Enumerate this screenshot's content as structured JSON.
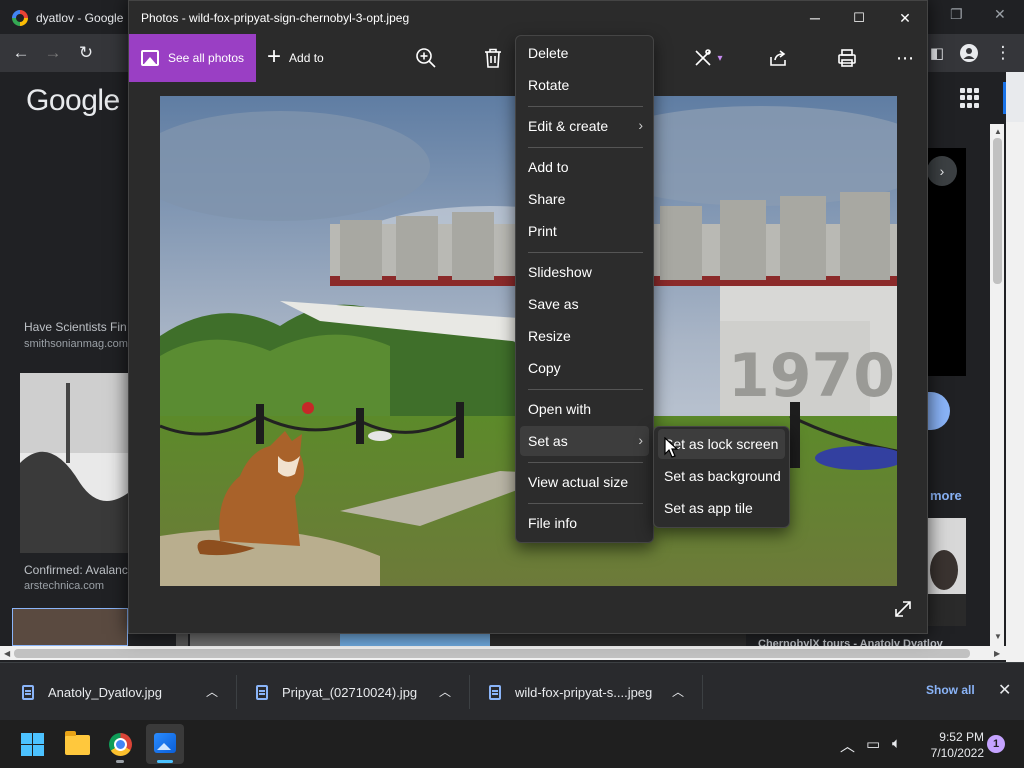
{
  "browser": {
    "tab_title": "dyatlov - Google",
    "logo_text": "Google",
    "cards": [
      {
        "title": "Have Scientists Fin",
        "source": "smithsonianmag.com"
      },
      {
        "title": "Confirmed: Avalanc",
        "source": "arstechnica.com"
      }
    ],
    "more_link": "more",
    "bottom_title": "ChernobylX tours - Anatoly Dyatlov"
  },
  "photos": {
    "window_title": "Photos - wild-fox-pripyat-sign-chernobyl-3-opt.jpeg",
    "see_all_label": "See all photos",
    "add_to_label": "Add to",
    "icons": [
      "zoom-in-icon",
      "delete-icon",
      "edit-icon",
      "share-icon",
      "print-icon",
      "more-icon",
      "expand-icon"
    ]
  },
  "context_menu": {
    "items": [
      {
        "label": "Delete"
      },
      {
        "label": "Rotate"
      },
      {
        "label": "Edit & create"
      },
      {
        "label": "Add to"
      },
      {
        "label": "Share"
      },
      {
        "label": "Print"
      },
      {
        "label": "Slideshow"
      },
      {
        "label": "Save as"
      },
      {
        "label": "Resize"
      },
      {
        "label": "Copy"
      },
      {
        "label": "Open with"
      },
      {
        "label": "Set as"
      },
      {
        "label": "View actual size"
      },
      {
        "label": "File info"
      }
    ],
    "submenu": [
      {
        "label": "Set as lock screen"
      },
      {
        "label": "Set as background"
      },
      {
        "label": "Set as app tile"
      }
    ]
  },
  "downloads": {
    "items": [
      {
        "name": "Anatoly_Dyatlov.jpg"
      },
      {
        "name": "Pripyat_(02710024).jpg"
      },
      {
        "name": "wild-fox-pripyat-s....jpeg"
      }
    ],
    "show_all": "Show all"
  },
  "taskbar": {
    "time": "9:52 PM",
    "date": "7/10/2022",
    "notification_count": "1"
  },
  "colors": {
    "photos_accent": "#9a3fc4",
    "link_blue": "#8ab4f8",
    "win_blue": "#4cc2ff"
  }
}
